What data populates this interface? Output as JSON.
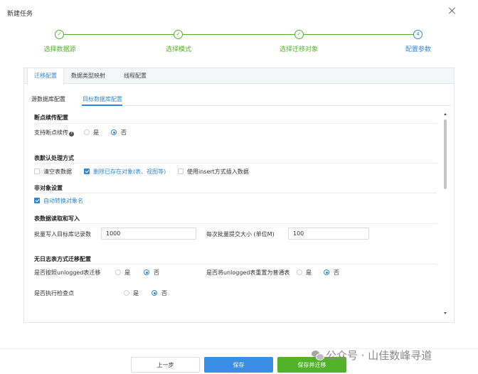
{
  "dialog": {
    "title": "新建任务"
  },
  "steps": [
    {
      "label": "选择数据源",
      "state": "done"
    },
    {
      "label": "选择模式",
      "state": "done"
    },
    {
      "label": "选择迁移对象",
      "state": "done"
    },
    {
      "label": "配置参数",
      "state": "active",
      "number": "4"
    }
  ],
  "tabs": [
    {
      "label": "迁移配置",
      "active": true
    },
    {
      "label": "数据类型映射",
      "active": false
    },
    {
      "label": "线程配置",
      "active": false
    }
  ],
  "subtabs": [
    {
      "label": "源数据库配置",
      "active": false
    },
    {
      "label": "目标数据库配置",
      "active": true
    }
  ],
  "sections": {
    "resume": {
      "title": "断点续传配置",
      "support_label": "支持断点续传",
      "help_glyph": "?",
      "yes": "是",
      "no": "否",
      "selected": "否"
    },
    "table_default": {
      "title": "表默认处理方式",
      "options": [
        {
          "label": "清空表数据",
          "checked": false
        },
        {
          "label": "删除已存在对象(表、视图等)",
          "checked": true
        },
        {
          "label": "使用insert方式插入数据",
          "checked": false
        }
      ]
    },
    "non_object": {
      "title": "非对象设置",
      "auto_convert_label": "自动转换对象名",
      "auto_convert_checked": true
    },
    "read_write": {
      "title": "表数据读取和写入",
      "batch_write_label": "批量写入目标库记录数",
      "batch_write_value": "1000",
      "batch_commit_label": "每次批量提交大小 (单位M)",
      "batch_commit_value": "100"
    },
    "no_log": {
      "title": "无日志表方式迁移配置",
      "unlogged_label": "是否按照unlogged表迁移",
      "unlogged_selected": "否",
      "reset_label": "是否将unlogged表重置为普通表",
      "reset_selected": "否",
      "checkpoint_label": "是否执行检查点",
      "checkpoint_selected": "否",
      "yes": "是",
      "no": "否"
    }
  },
  "footer": {
    "prev_label": "上一步",
    "save_label": "保存",
    "save_migrate_label": "保存并迁移"
  },
  "watermark": {
    "text": "公众号 · 山佳数峰寻道"
  },
  "colors": {
    "success": "#52b32a",
    "primary": "#2f88d6",
    "save_button": "#3a8ee6"
  }
}
